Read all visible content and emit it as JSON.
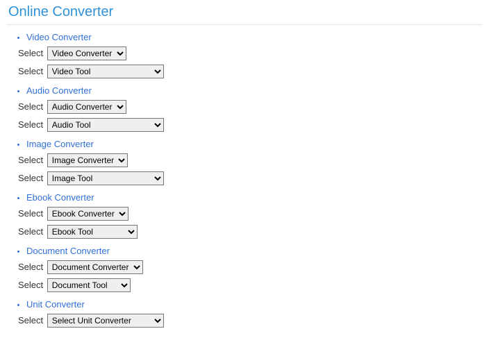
{
  "page": {
    "title": "Online Converter"
  },
  "labels": {
    "select": "Select"
  },
  "items": [
    {
      "key": "video",
      "link": "Video Converter",
      "converter_value": "Video Converter",
      "tool_value": "Video Tool"
    },
    {
      "key": "audio",
      "link": "Audio Converter",
      "converter_value": "Audio Converter",
      "tool_value": "Audio Tool"
    },
    {
      "key": "image",
      "link": "Image Converter",
      "converter_value": "Image Converter",
      "tool_value": "Image Tool"
    },
    {
      "key": "ebook",
      "link": "Ebook Converter",
      "converter_value": "Ebook Converter",
      "tool_value": "Ebook Tool"
    },
    {
      "key": "document",
      "link": "Document Converter",
      "converter_value": "Document Converter",
      "tool_value": "Document Tool"
    },
    {
      "key": "unit",
      "link": "Unit Converter",
      "converter_value": "Select Unit Converter",
      "tool_value": null
    }
  ]
}
